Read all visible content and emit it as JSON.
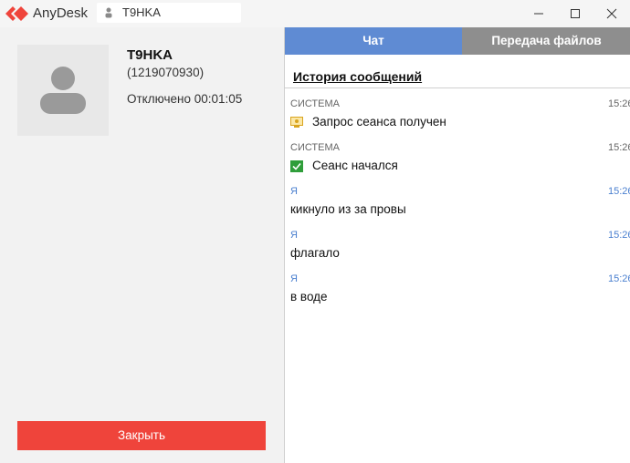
{
  "titlebar": {
    "app_name": "AnyDesk",
    "address": "T9HKA",
    "icons": [
      "anydesk-logo",
      "person-icon",
      "minimize-icon",
      "maximize-icon",
      "close-icon"
    ]
  },
  "peer": {
    "name": "T9HKA",
    "id": "(1219070930)",
    "status": "Отключено 00:01:05"
  },
  "actions": {
    "close_label": "Закрыть"
  },
  "tabs": {
    "chat": "Чат",
    "files": "Передача файлов"
  },
  "history": {
    "title": "История сообщений",
    "messages": [
      {
        "sender": "СИСТЕМА",
        "time": "15:26",
        "text": "Запрос сеанса получен",
        "icon": "session-request-icon"
      },
      {
        "sender": "СИСТЕМА",
        "time": "15:26",
        "text": "Сеанс начался",
        "icon": "session-started-icon"
      },
      {
        "sender": "Я",
        "time": "15:26",
        "text": "кикнуло из за провы"
      },
      {
        "sender": "Я",
        "time": "15:26",
        "text": "флагало"
      },
      {
        "sender": "Я",
        "time": "15:26",
        "text": "в воде"
      }
    ]
  },
  "colors": {
    "accent_red": "#ef443b",
    "tab_active": "#5f8bd3",
    "tab_inactive": "#8e8e8e",
    "me_color": "#4a7fcf",
    "system_color": "#666666"
  }
}
